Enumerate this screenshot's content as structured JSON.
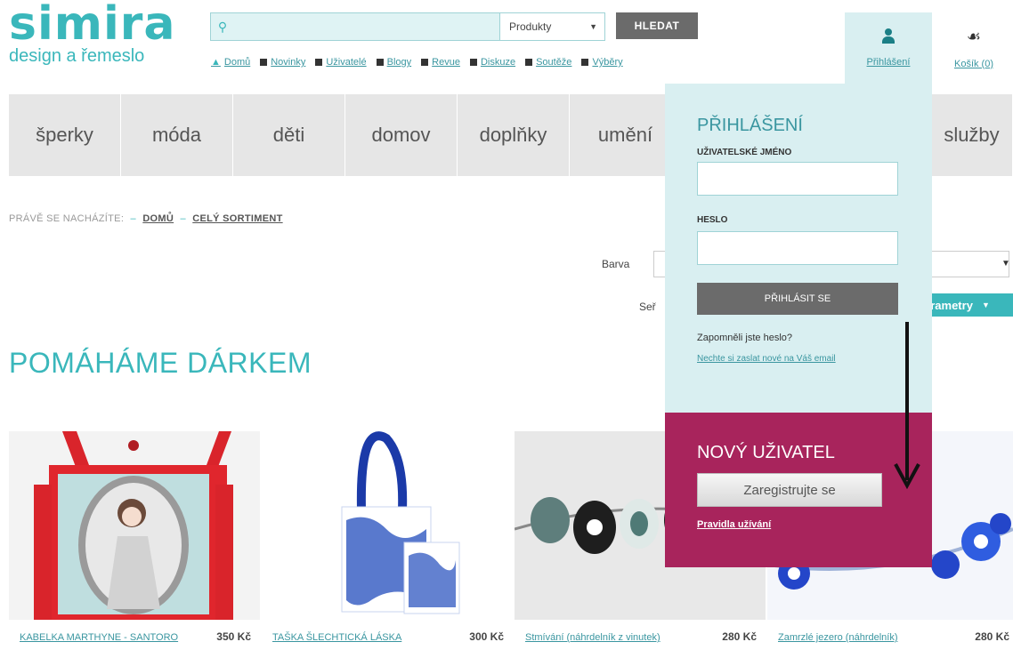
{
  "logo": {
    "name": "simira",
    "tagline": "design a řemeslo"
  },
  "search": {
    "placeholder": "",
    "category": "Produkty",
    "button": "HLEDAT"
  },
  "toplinks": [
    {
      "label": "Domů",
      "icon": "home-icon"
    },
    {
      "label": "Novinky"
    },
    {
      "label": "Uživatelé"
    },
    {
      "label": "Blogy"
    },
    {
      "label": "Revue"
    },
    {
      "label": "Diskuze"
    },
    {
      "label": "Soutěže"
    },
    {
      "label": "Výběry"
    }
  ],
  "account": {
    "label": "Přihlášení",
    "icon": "user-icon"
  },
  "cart": {
    "label": "Košík (0)",
    "icon": "basket-icon"
  },
  "categories": [
    "šperky",
    "móda",
    "děti",
    "domov",
    "doplňky",
    "umění",
    "služby"
  ],
  "breadcrumb": {
    "prefix": "PRÁVĚ SE NACHÁZÍTE:",
    "items": [
      "DOMŮ",
      "CELÝ SORTIMENT"
    ]
  },
  "filters": {
    "color_label": "Barva",
    "sort_label": "Seř",
    "params_button": "arametry"
  },
  "heading": "POMÁHÁME DÁRKEM",
  "products": [
    {
      "name": "KABELKA MARTHYNE - SANTORO",
      "price": "350 Kč"
    },
    {
      "name": "TAŠKA ŠLECHTICKÁ LÁSKA",
      "price": "300 Kč"
    },
    {
      "name": "Stmívání (náhrdelník z vinutek)",
      "price": "280 Kč"
    },
    {
      "name": "Zamrzlé jezero (náhrdelník)",
      "price": "280 Kč"
    }
  ],
  "login": {
    "title": "PŘIHLÁŠENÍ",
    "username_label": "UŽIVATELSKÉ JMÉNO",
    "password_label": "HESLO",
    "submit": "PŘIHLÁSIT SE",
    "forgot": "Zapomněli jste heslo?",
    "send_link": "Nechte si zaslat nové na Váš email"
  },
  "register": {
    "title": "NOVÝ UŽIVATEL",
    "button": "Zaregistrujte se",
    "rules": "Pravidla užívání"
  },
  "colors": {
    "accent": "#3ab7bb",
    "register_bg": "#a8245c",
    "panel_bg": "#d9eff1"
  }
}
